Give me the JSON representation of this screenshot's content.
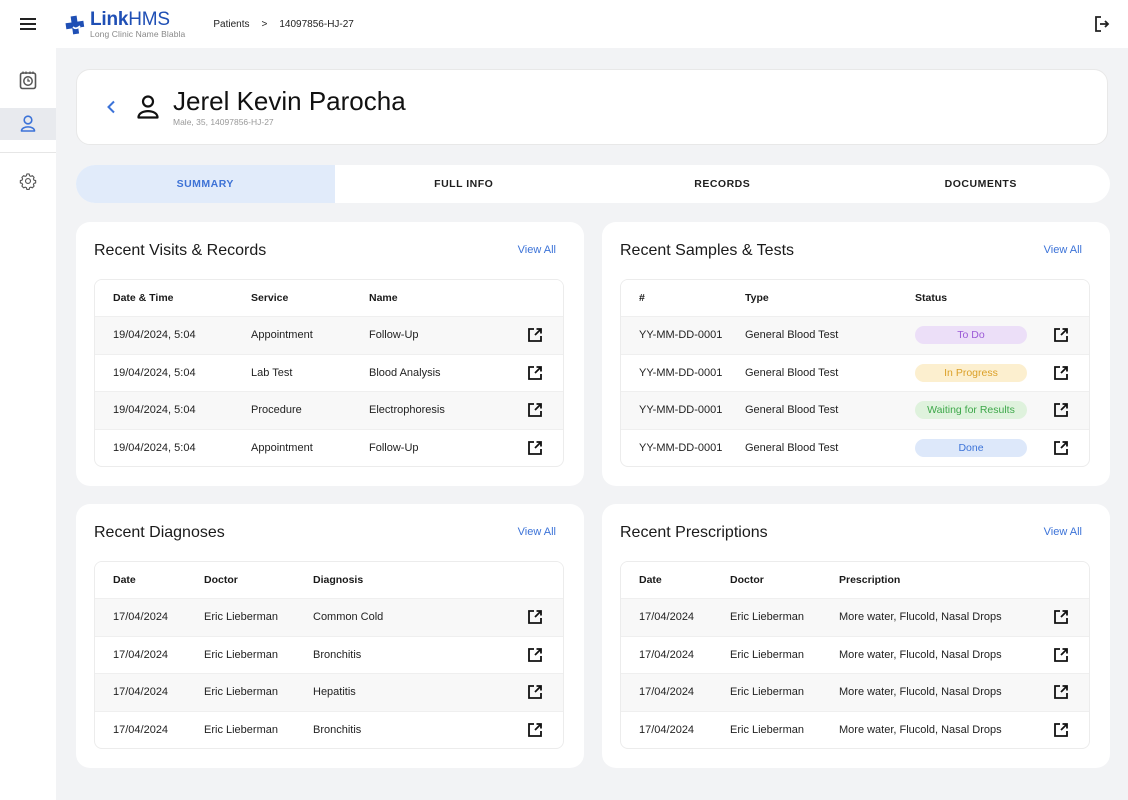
{
  "header": {
    "menu_icon": "hamburger-menu-icon",
    "logo": {
      "name_bold": "Link",
      "name_rest": "HMS",
      "subtitle": "Long Clinic Name Blabla"
    },
    "breadcrumb": [
      "Patients",
      "14097856-HJ-27"
    ],
    "breadcrumb_separator": ">",
    "logout_icon": "logout-icon"
  },
  "sidebar": {
    "items": [
      {
        "icon": "calendar-clock-icon",
        "active": false
      },
      {
        "icon": "person-icon",
        "active": true
      },
      {
        "icon": "gear-icon",
        "active": false
      }
    ]
  },
  "patient": {
    "name": "Jerel Kevin Parocha",
    "meta": "Male, 35, 14097856-HJ-27"
  },
  "tabs": [
    {
      "label": "SUMMARY",
      "active": true
    },
    {
      "label": "FULL INFO",
      "active": false
    },
    {
      "label": "RECORDS",
      "active": false
    },
    {
      "label": "DOCUMENTS",
      "active": false
    }
  ],
  "colors": {
    "accent": "#3c73d8",
    "brand": "#1f4fb5",
    "status": {
      "To Do": {
        "bg": "#ecdff8",
        "fg": "#9b59d6"
      },
      "In Progress": {
        "bg": "#fcefcf",
        "fg": "#dba028"
      },
      "Waiting for Results": {
        "bg": "#dff2dd",
        "fg": "#3ea84a"
      },
      "Done": {
        "bg": "#dde8fa",
        "fg": "#3c73d8"
      }
    }
  },
  "panels": {
    "visits": {
      "title": "Recent Visits & Records",
      "view_all": "View All",
      "columns": [
        "Date & Time",
        "Service",
        "Name"
      ],
      "rows": [
        [
          "19/04/2024, 5:04",
          "Appointment",
          "Follow-Up"
        ],
        [
          "19/04/2024, 5:04",
          "Lab Test",
          "Blood Analysis"
        ],
        [
          "19/04/2024, 5:04",
          "Procedure",
          "Electrophoresis"
        ],
        [
          "19/04/2024, 5:04",
          "Appointment",
          "Follow-Up"
        ]
      ]
    },
    "samples": {
      "title": "Recent Samples & Tests",
      "view_all": "View All",
      "columns": [
        "#",
        "Type",
        "Status"
      ],
      "rows": [
        [
          "YY-MM-DD-0001",
          "General Blood Test",
          "To Do"
        ],
        [
          "YY-MM-DD-0001",
          "General Blood Test",
          "In Progress"
        ],
        [
          "YY-MM-DD-0001",
          "General Blood Test",
          "Waiting for Results"
        ],
        [
          "YY-MM-DD-0001",
          "General Blood Test",
          "Done"
        ]
      ]
    },
    "diagnoses": {
      "title": "Recent Diagnoses",
      "view_all": "View All",
      "columns": [
        "Date",
        "Doctor",
        "Diagnosis"
      ],
      "rows": [
        [
          "17/04/2024",
          "Eric Lieberman",
          "Common Cold"
        ],
        [
          "17/04/2024",
          "Eric Lieberman",
          "Bronchitis"
        ],
        [
          "17/04/2024",
          "Eric Lieberman",
          "Hepatitis"
        ],
        [
          "17/04/2024",
          "Eric Lieberman",
          "Bronchitis"
        ]
      ]
    },
    "prescriptions": {
      "title": "Recent Prescriptions",
      "view_all": "View All",
      "columns": [
        "Date",
        "Doctor",
        "Prescription"
      ],
      "rows": [
        [
          "17/04/2024",
          "Eric Lieberman",
          "More water, Flucold, Nasal Drops"
        ],
        [
          "17/04/2024",
          "Eric Lieberman",
          "More water, Flucold, Nasal Drops"
        ],
        [
          "17/04/2024",
          "Eric Lieberman",
          "More water, Flucold, Nasal Drops"
        ],
        [
          "17/04/2024",
          "Eric Lieberman",
          "More water, Flucold, Nasal Drops"
        ]
      ]
    }
  }
}
